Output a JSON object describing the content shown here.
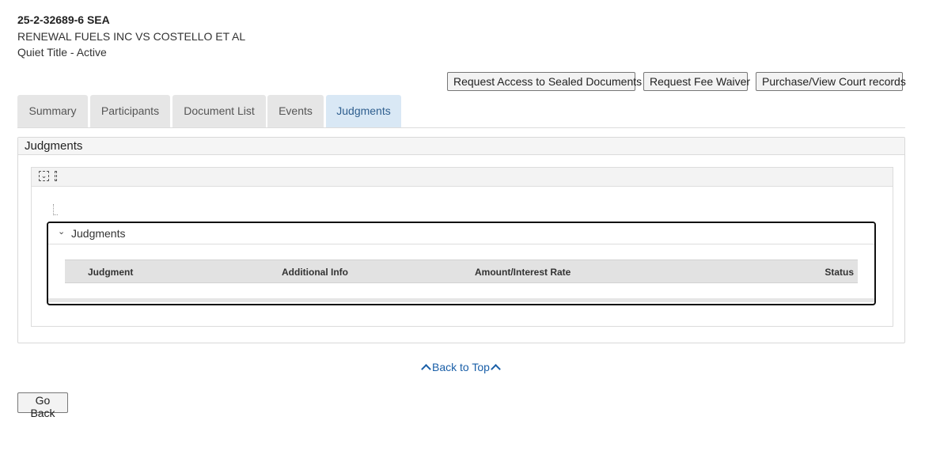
{
  "case": {
    "number": "25-2-32689-6 SEA",
    "title": "RENEWAL FUELS INC VS COSTELLO ET AL",
    "type_status": "Quiet Title - Active"
  },
  "actions": {
    "sealed": "Request Access to Sealed Documents",
    "fee_waiver": "Request Fee Waiver",
    "purchase": "Purchase/View Court records"
  },
  "tabs": [
    {
      "label": "Summary",
      "active": false
    },
    {
      "label": "Participants",
      "active": false
    },
    {
      "label": "Document List",
      "active": false
    },
    {
      "label": "Events",
      "active": false
    },
    {
      "label": "Judgments",
      "active": true
    }
  ],
  "panel": {
    "title": "Judgments"
  },
  "judgments_section": {
    "title": "Judgments",
    "columns": [
      "Judgment",
      "Additional Info",
      "Amount/Interest Rate",
      "Status"
    ]
  },
  "footer": {
    "back_to_top": "Back to Top",
    "go_back": "Go Back"
  },
  "colors": {
    "active_tab_bg": "#d9e8f5",
    "link": "#1a5fa8"
  },
  "icons": {
    "collapse": "collapse-icon",
    "drag": "drag-handle-icon",
    "chevron": "chevron-down-icon",
    "caret_up": "caret-up-icon"
  }
}
